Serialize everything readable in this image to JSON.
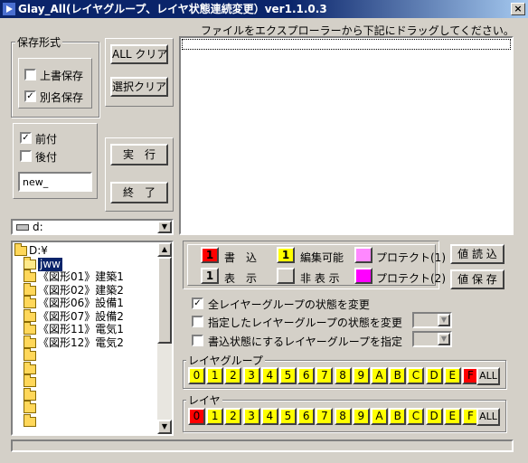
{
  "window": {
    "title": "Glay_All(レイヤグループ、レイヤ状態連続変更）ver1.1.0.3",
    "close_glyph": "×"
  },
  "save_format": {
    "legend": "保存形式",
    "overwrite_label": "上書保存",
    "overwrite_checked": false,
    "rename_label": "別名保存",
    "rename_checked": true,
    "prefix_label": "前付",
    "prefix_checked": true,
    "suffix_label": "後付",
    "suffix_checked": false,
    "name_value": "new_"
  },
  "buttons": {
    "all_clear": "ALL クリア",
    "select_clear": "選択クリア",
    "run": "実　行",
    "exit": "終　了",
    "read_values": "値 読 込",
    "save_values": "値 保 存"
  },
  "drop_area": {
    "instruction": "ファイルをエクスプローラーから下記にドラッグしてください。"
  },
  "drive": {
    "selected": "d:"
  },
  "tree": {
    "items": [
      {
        "label": "D:¥",
        "level": 0,
        "selected": false
      },
      {
        "label": "jww",
        "level": 1,
        "selected": true
      },
      {
        "label": "《図形01》建築1",
        "level": 1,
        "selected": false
      },
      {
        "label": "《図形02》建築2",
        "level": 1,
        "selected": false
      },
      {
        "label": "《図形06》設備1",
        "level": 1,
        "selected": false
      },
      {
        "label": "《図形07》設備2",
        "level": 1,
        "selected": false
      },
      {
        "label": "《図形11》電気1",
        "level": 1,
        "selected": false
      },
      {
        "label": "《図形12》電気2",
        "level": 1,
        "selected": false
      },
      {
        "label": "",
        "level": 1,
        "selected": false
      },
      {
        "label": "",
        "level": 1,
        "selected": false
      },
      {
        "label": "",
        "level": 1,
        "selected": false
      },
      {
        "label": "",
        "level": 1,
        "selected": false
      },
      {
        "label": "",
        "level": 1,
        "selected": false
      },
      {
        "label": "",
        "level": 1,
        "selected": false
      }
    ]
  },
  "legend_panel": {
    "write_num": "1",
    "write_label": "書　込",
    "editable_num": "1",
    "editable_label": "編集可能",
    "protect1_label": "プロテクト(1)",
    "display_num": "1",
    "display_label": "表　示",
    "hidden_label": "非 表 示",
    "protect2_label": "プロテクト(2)",
    "colors": {
      "write": "#ff0000",
      "editable": "#ffff00",
      "protect1": "#ff88ff",
      "display": "#d4d0c8",
      "hidden": "#d4d0c8",
      "protect2": "#ff00ff"
    }
  },
  "options": {
    "change_all_label": "全レイヤーグループの状態を変更",
    "change_all_checked": true,
    "change_specified_label": "指定したレイヤーグループの状態を変更",
    "change_specified_checked": false,
    "write_group_label": "書込状態にするレイヤーグループを指定",
    "write_group_checked": false
  },
  "layer_group": {
    "legend": "レイヤグループ",
    "buttons": [
      "0",
      "1",
      "2",
      "3",
      "4",
      "5",
      "6",
      "7",
      "8",
      "9",
      "A",
      "B",
      "C",
      "D",
      "E",
      "F"
    ],
    "active": "F",
    "all_label": "ALL"
  },
  "layer": {
    "legend": "レイヤ",
    "buttons": [
      "0",
      "1",
      "2",
      "3",
      "4",
      "5",
      "6",
      "7",
      "8",
      "9",
      "A",
      "B",
      "C",
      "D",
      "E",
      "F"
    ],
    "active": "0",
    "all_label": "ALL"
  },
  "colors": {
    "title_bar": "#0a246a",
    "face": "#d4d0c8",
    "button_yellow": "#ffff00",
    "button_red": "#ff0000",
    "selection": "#0a246a"
  }
}
